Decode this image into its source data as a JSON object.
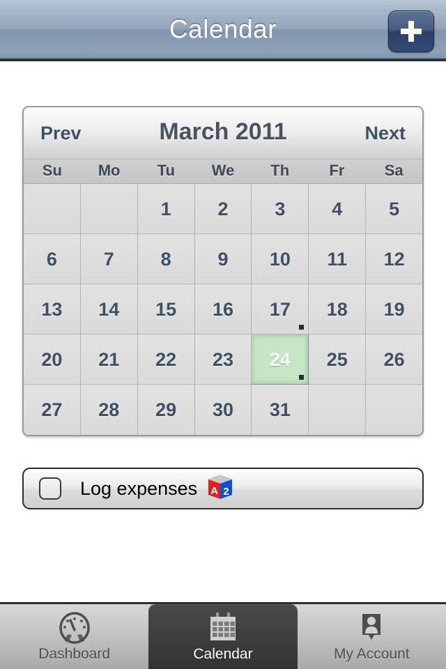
{
  "header": {
    "title": "Calendar",
    "add_button_label": "+",
    "add_button_icon": "plus-icon"
  },
  "calendar": {
    "prev_label": "Prev",
    "next_label": "Next",
    "month_title": "March 2011",
    "day_headers": [
      "Su",
      "Mo",
      "Tu",
      "We",
      "Th",
      "Fr",
      "Sa"
    ],
    "selected_day": 24,
    "days_with_events": [
      17,
      24
    ],
    "selected_color": "#c6e6c5",
    "weeks": [
      [
        {
          "label": "",
          "empty": true
        },
        {
          "label": "",
          "empty": true
        },
        {
          "label": "1"
        },
        {
          "label": "2"
        },
        {
          "label": "3"
        },
        {
          "label": "4"
        },
        {
          "label": "5"
        }
      ],
      [
        {
          "label": "6"
        },
        {
          "label": "7"
        },
        {
          "label": "8"
        },
        {
          "label": "9"
        },
        {
          "label": "10"
        },
        {
          "label": "11"
        },
        {
          "label": "12"
        }
      ],
      [
        {
          "label": "13"
        },
        {
          "label": "14"
        },
        {
          "label": "15"
        },
        {
          "label": "16"
        },
        {
          "label": "17",
          "event": true
        },
        {
          "label": "18"
        },
        {
          "label": "19"
        }
      ],
      [
        {
          "label": "20"
        },
        {
          "label": "21"
        },
        {
          "label": "22"
        },
        {
          "label": "23"
        },
        {
          "label": "24",
          "event": true,
          "selected": true
        },
        {
          "label": "25"
        },
        {
          "label": "26"
        }
      ],
      [
        {
          "label": "27"
        },
        {
          "label": "28"
        },
        {
          "label": "29"
        },
        {
          "label": "30"
        },
        {
          "label": "31"
        },
        {
          "label": "",
          "empty": true
        },
        {
          "label": "",
          "empty": true
        }
      ]
    ]
  },
  "task": {
    "label": "Log expenses",
    "checked": false,
    "icon": "a2-cube-icon",
    "icon_left_face_text": "A",
    "icon_right_face_text": "2",
    "icon_left_color": "#e02020",
    "icon_right_color": "#1050d8"
  },
  "tabbar": {
    "tabs": [
      {
        "label": "Dashboard",
        "icon": "gauge-icon",
        "active": false
      },
      {
        "label": "Calendar",
        "icon": "calendar-icon",
        "active": true
      },
      {
        "label": "My Account",
        "icon": "person-badge-icon",
        "active": false
      }
    ]
  }
}
